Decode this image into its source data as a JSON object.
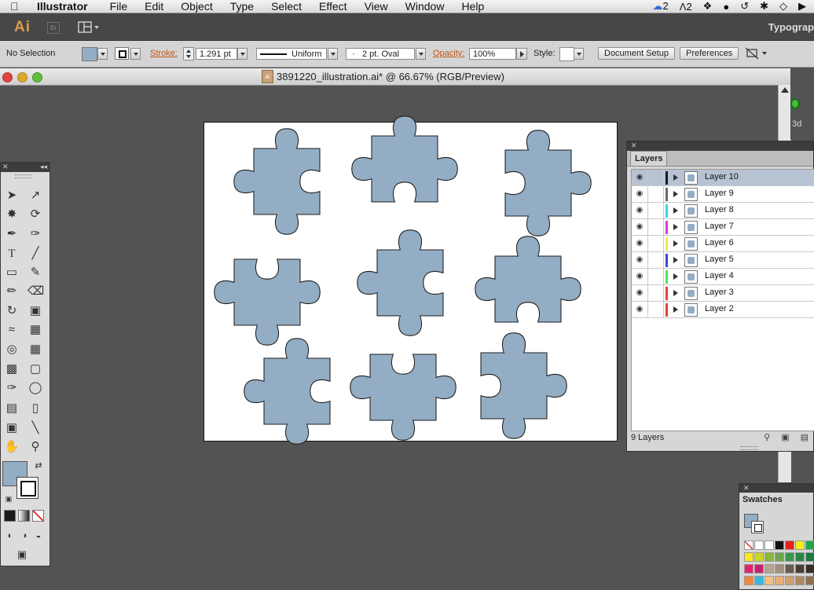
{
  "menubar": {
    "app_name": "Illustrator",
    "items": [
      "File",
      "Edit",
      "Object",
      "Type",
      "Select",
      "Effect",
      "View",
      "Window",
      "Help"
    ],
    "status_count_a": "2",
    "status_count_b": "2"
  },
  "appbar": {
    "logo": "Ai",
    "bridge": "Br",
    "workspace": "Typograp"
  },
  "controlbar": {
    "selection": "No Selection",
    "stroke_label": "Stroke:",
    "stroke_weight": "1.291 pt",
    "profile": "Uniform",
    "brush": "2 pt. Oval",
    "opacity_label": "Opacity:",
    "opacity_value": "100%",
    "style_label": "Style:",
    "document_setup": "Document Setup",
    "preferences": "Preferences"
  },
  "document": {
    "title": "3891220_illustration.ai* @ 66.67% (RGB/Preview)",
    "fill_color": "#93adc4"
  },
  "layers_panel": {
    "title": "Layers",
    "layers": [
      {
        "name": "Layer 10",
        "color": "#1a1a1a",
        "selected": true
      },
      {
        "name": "Layer 9",
        "color": "#6a6a6a",
        "selected": false
      },
      {
        "name": "Layer 8",
        "color": "#35d7e6",
        "selected": false
      },
      {
        "name": "Layer 7",
        "color": "#d43fd6",
        "selected": false
      },
      {
        "name": "Layer 6",
        "color": "#efe94a",
        "selected": false
      },
      {
        "name": "Layer 5",
        "color": "#3d45d1",
        "selected": false
      },
      {
        "name": "Layer 4",
        "color": "#4ee05a",
        "selected": false
      },
      {
        "name": "Layer 3",
        "color": "#e6403e",
        "selected": false
      },
      {
        "name": "Layer 2",
        "color": "#e6403e",
        "selected": false
      }
    ],
    "footer": "9 Layers"
  },
  "swatches_panel": {
    "title": "Swatches"
  }
}
